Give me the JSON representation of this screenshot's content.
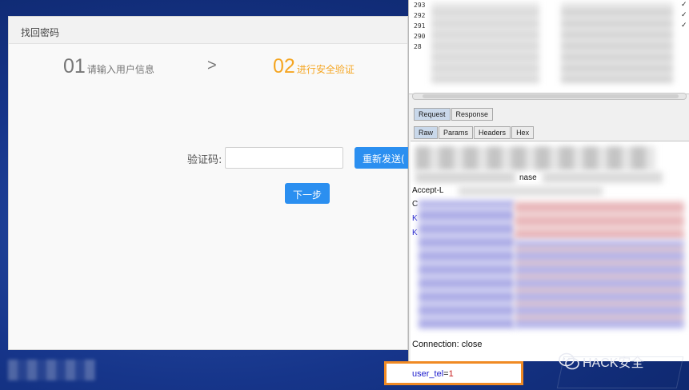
{
  "dialog": {
    "title": "找回密码",
    "step1_num": "01",
    "step1_label": "请输入用户信息",
    "step_arrow": ">",
    "step2_num": "02",
    "step2_label": "进行安全验证",
    "code_label": "验证码:",
    "code_value": "",
    "resend_label": "重新发送(",
    "next_label": "下一步"
  },
  "history": {
    "row_ids": [
      "293",
      "292",
      "291",
      "290",
      "28"
    ]
  },
  "tabs_top": [
    "Request",
    "Response"
  ],
  "tabs_bottom": [
    "Raw",
    "Params",
    "Headers",
    "Hex"
  ],
  "request": {
    "partial_text_1": "nase",
    "partial_text_2": "Accept-L",
    "letter_c": "C",
    "letter_k1": "K",
    "letter_k2": "K",
    "connection": "Connection: close",
    "param_key": "user_tel",
    "param_eq": "=",
    "param_value": "1"
  },
  "watermark": {
    "brand": "HACK安全"
  },
  "colors": {
    "accent_blue": "#2b8ff0",
    "step_active": "#f5a623",
    "highlight_box": "#f08a24",
    "param_key": "#1a1acc",
    "param_value": "#c81e1e"
  }
}
